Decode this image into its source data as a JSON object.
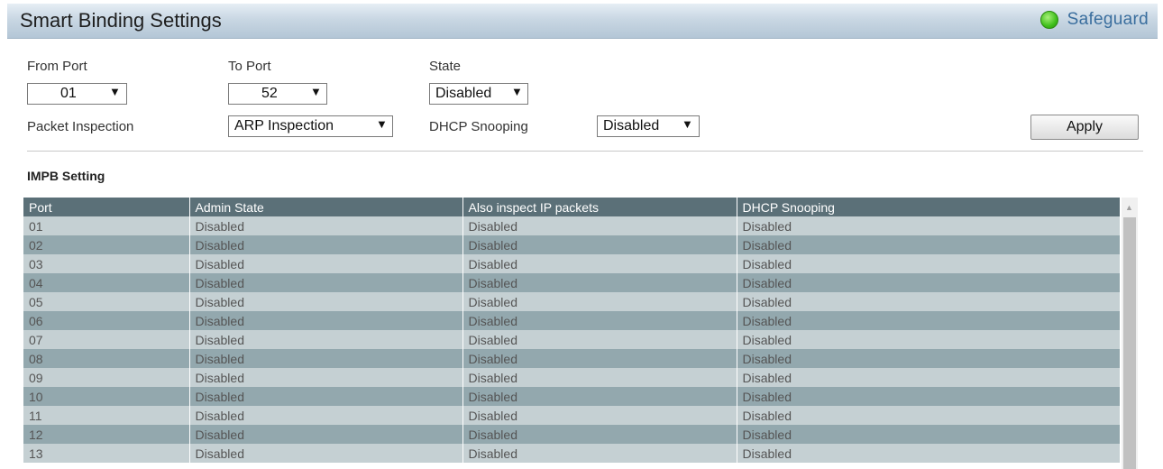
{
  "header": {
    "title": "Smart Binding Settings",
    "safeguard_label": "Safeguard"
  },
  "form": {
    "from_port": {
      "label": "From Port",
      "value": "01"
    },
    "to_port": {
      "label": "To Port",
      "value": "52"
    },
    "state": {
      "label": "State",
      "value": "Disabled"
    },
    "packet_inspection": {
      "label": "Packet Inspection",
      "value": "ARP Inspection"
    },
    "dhcp_snooping": {
      "label": "DHCP Snooping",
      "value": "Disabled"
    },
    "apply_label": "Apply"
  },
  "section_title": "IMPB Setting",
  "table": {
    "headers": [
      "Port",
      "Admin State",
      "Also inspect IP packets",
      "DHCP Snooping"
    ],
    "rows": [
      [
        "01",
        "Disabled",
        "Disabled",
        "Disabled"
      ],
      [
        "02",
        "Disabled",
        "Disabled",
        "Disabled"
      ],
      [
        "03",
        "Disabled",
        "Disabled",
        "Disabled"
      ],
      [
        "04",
        "Disabled",
        "Disabled",
        "Disabled"
      ],
      [
        "05",
        "Disabled",
        "Disabled",
        "Disabled"
      ],
      [
        "06",
        "Disabled",
        "Disabled",
        "Disabled"
      ],
      [
        "07",
        "Disabled",
        "Disabled",
        "Disabled"
      ],
      [
        "08",
        "Disabled",
        "Disabled",
        "Disabled"
      ],
      [
        "09",
        "Disabled",
        "Disabled",
        "Disabled"
      ],
      [
        "10",
        "Disabled",
        "Disabled",
        "Disabled"
      ],
      [
        "11",
        "Disabled",
        "Disabled",
        "Disabled"
      ],
      [
        "12",
        "Disabled",
        "Disabled",
        "Disabled"
      ],
      [
        "13",
        "Disabled",
        "Disabled",
        "Disabled"
      ]
    ]
  },
  "icons": {
    "safeguard": "status-dot-icon",
    "dropdown": "dropdown-arrow-icon",
    "scroll_up": "scroll-up-arrow-icon"
  },
  "colors": {
    "header_row": "#5b7078",
    "row_light": "#c5d0d3",
    "row_dark": "#93a8ae",
    "safeguard_dot": "#3fbf1b",
    "safeguard_text": "#3a6e9e"
  }
}
